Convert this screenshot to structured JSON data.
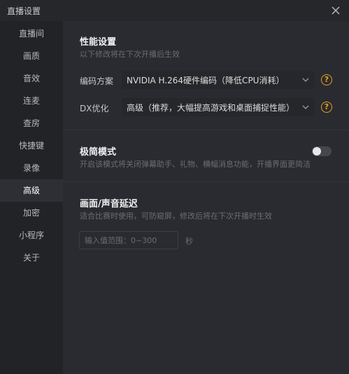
{
  "window": {
    "title": "直播设置"
  },
  "sidebar": {
    "items": [
      {
        "label": "直播间",
        "active": false
      },
      {
        "label": "画质",
        "active": false
      },
      {
        "label": "音效",
        "active": false
      },
      {
        "label": "连麦",
        "active": false
      },
      {
        "label": "查房",
        "active": false
      },
      {
        "label": "快捷键",
        "active": false
      },
      {
        "label": "录像",
        "active": false
      },
      {
        "label": "高级",
        "active": true
      },
      {
        "label": "加密",
        "active": false
      },
      {
        "label": "小程序",
        "active": false
      },
      {
        "label": "关于",
        "active": false
      }
    ]
  },
  "performance": {
    "title": "性能设置",
    "subtitle": "以下修改将在下次开播后生效",
    "encoder": {
      "label": "编码方案",
      "value": "NVIDIA H.264硬件编码（降低CPU消耗）"
    },
    "dx": {
      "label": "DX优化",
      "value": "高级（推荐，大幅提高游戏和桌面捕捉性能）"
    }
  },
  "minimal_mode": {
    "title": "极简模式",
    "description": "开启该模式将关闭弹幕助手、礼物、横幅消息功能，开播界面更简洁",
    "enabled": false
  },
  "delay": {
    "title": "画面/声音延迟",
    "description": "适合比赛时使用，可防窥屏，修改后将在下次开播时生效",
    "input_value": "",
    "input_placeholder": "输入值范围：0~300",
    "unit": "秒"
  },
  "colors": {
    "help_accent": "#e3a21f",
    "active_nav": "#2e2f34"
  }
}
